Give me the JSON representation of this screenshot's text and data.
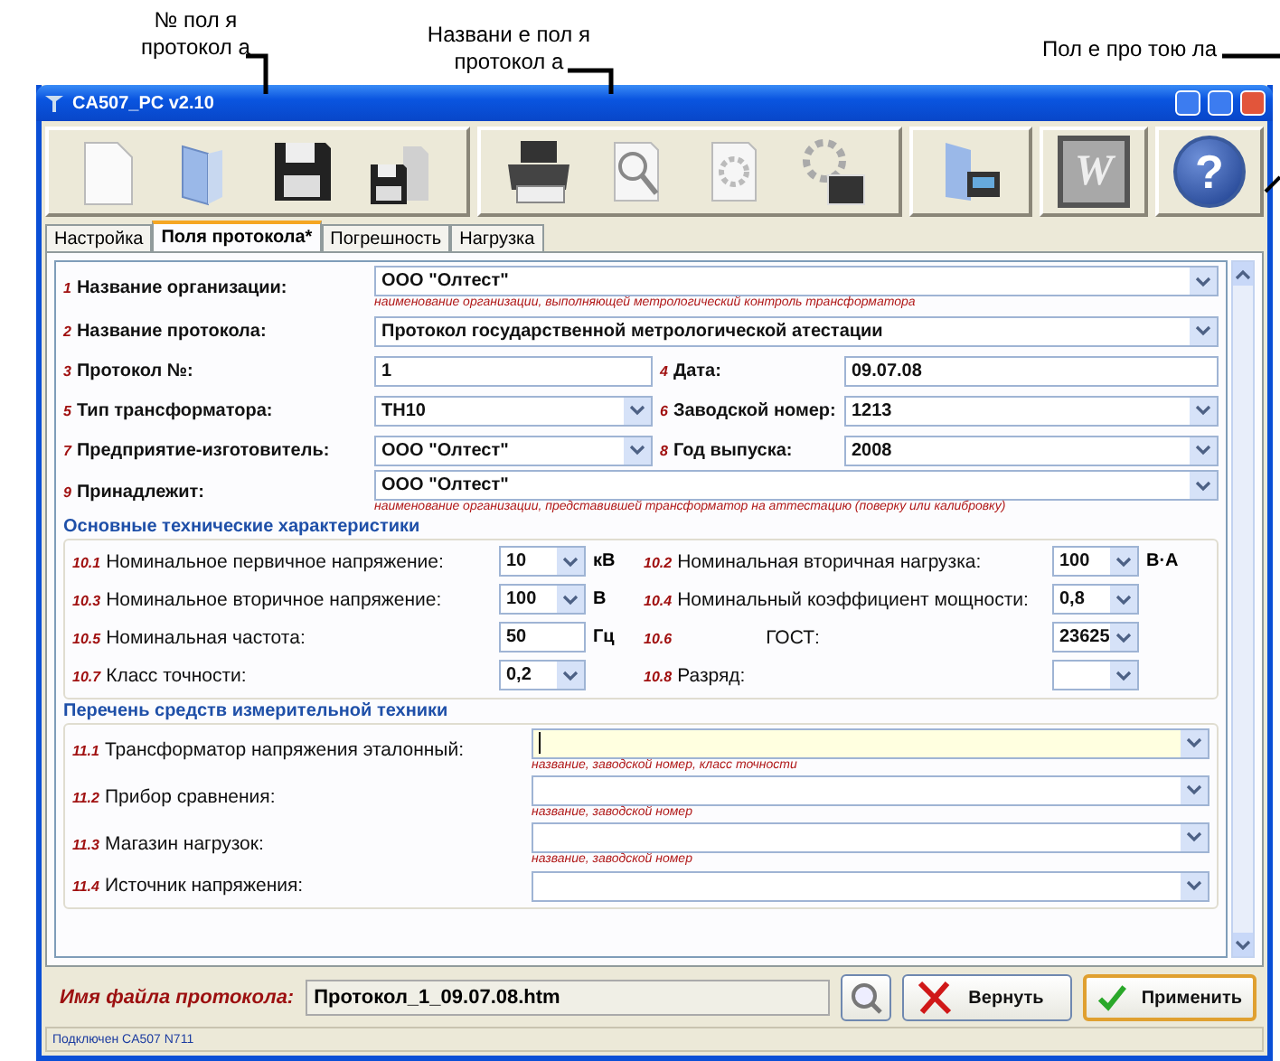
{
  "annotations": [
    {
      "lines": [
        "№ пол я",
        "протокол а"
      ]
    },
    {
      "lines": [
        "Названи е пол я",
        "протокол а"
      ]
    },
    {
      "lines": [
        "Пол е про тою ла"
      ]
    }
  ],
  "window": {
    "title": "CA507_PC v2.10"
  },
  "toolbar": [
    {
      "kind": "group",
      "items": [
        {
          "kind": "new-document"
        },
        {
          "kind": "open-folder"
        },
        {
          "kind": "floppy"
        },
        {
          "kind": "floppy-small"
        }
      ]
    },
    {
      "kind": "group",
      "items": [
        {
          "kind": "printer"
        },
        {
          "kind": "preview"
        },
        {
          "kind": "page-settings"
        },
        {
          "kind": "print-settings"
        }
      ]
    },
    {
      "kind": "group",
      "items": [
        {
          "kind": "folder-device"
        }
      ]
    },
    {
      "kind": "group",
      "items": [
        {
          "kind": "word",
          "label": "W"
        }
      ]
    },
    {
      "kind": "group",
      "items": [
        {
          "kind": "help",
          "label": "?"
        }
      ]
    }
  ],
  "tabs": [
    {
      "label": "Настройка",
      "selected": false
    },
    {
      "label": "Поля протокола*",
      "selected": true
    },
    {
      "label": "Погрешность",
      "selected": false
    },
    {
      "label": "Нагрузка",
      "selected": false
    }
  ],
  "sections": [
    {
      "kind": "fields",
      "rows": [
        {
          "fields": [
            {
              "num": "1",
              "label": "Название организации:",
              "value": "ООО \"Олтест\"",
              "kind": "combo",
              "hint": "наименование организации, выполняющей метрологический контроль трансформатора"
            }
          ]
        },
        {
          "fields": [
            {
              "num": "2",
              "label": "Название протокола:",
              "value": "Протокол государственной метрологической атестации",
              "kind": "combo"
            }
          ]
        },
        {
          "fields": [
            {
              "num": "3",
              "label": "Протокол №:",
              "value": "1",
              "kind": "text"
            },
            {
              "num": "4",
              "label": "Дата:",
              "value": "09.07.08",
              "kind": "text"
            }
          ]
        },
        {
          "fields": [
            {
              "num": "5",
              "label": "Тип трансформатора:",
              "value": "ТН10",
              "kind": "combo"
            },
            {
              "num": "6",
              "label": "Заводской номер:",
              "value": "1213",
              "kind": "combo"
            }
          ]
        },
        {
          "fields": [
            {
              "num": "7",
              "label": "Предприятие-изготовитель:",
              "value": "ООО \"Олтест\"",
              "kind": "combo"
            },
            {
              "num": "8",
              "label": "Год выпуска:",
              "value": "2008",
              "kind": "combo"
            }
          ]
        },
        {
          "fields": [
            {
              "num": "9",
              "label": "Принадлежит:",
              "value": "ООО \"Олтест\"",
              "kind": "combo",
              "hint": "наименование организации, представившей трансформатор на аттестацию (поверку или калибровку)"
            }
          ]
        }
      ]
    },
    {
      "kind": "grid",
      "title": "Основные технические характеристики",
      "rows": [
        {
          "fields": [
            {
              "num": "10.1",
              "label": "Номинальное первичное напряжение:",
              "value": "10",
              "kind": "combo",
              "unit": "кВ"
            },
            {
              "num": "10.2",
              "label": "Номинальная вторичная нагрузка:",
              "value": "100",
              "kind": "combo",
              "unit": "В·А"
            }
          ]
        },
        {
          "fields": [
            {
              "num": "10.3",
              "label": "Номинальное вторичное напряжение:",
              "value": "100",
              "kind": "combo",
              "unit": "В"
            },
            {
              "num": "10.4",
              "label": "Номинальный коэффициент мощности:",
              "value": "0,8",
              "kind": "combo"
            }
          ]
        },
        {
          "fields": [
            {
              "num": "10.5",
              "label": "Номинальная частота:",
              "value": "50",
              "kind": "text",
              "unit": "Гц"
            },
            {
              "num": "10.6",
              "label": "ГОСТ:",
              "value": "23625",
              "kind": "combo",
              "blank": true
            }
          ]
        },
        {
          "fields": [
            {
              "num": "10.7",
              "label": "Класс точности:",
              "value": "0,2",
              "kind": "combo"
            },
            {
              "num": "10.8",
              "label": "Разряд:",
              "kind": "combo"
            }
          ]
        }
      ]
    },
    {
      "kind": "list",
      "title": "Перечень средств измерительной техники",
      "rows": [
        {
          "fields": [
            {
              "num": "11.1",
              "label": "Трансформатор напряжения эталонный:",
              "kind": "combo",
              "focused": true,
              "hint": "название, заводской номер, класс точности"
            }
          ]
        },
        {
          "fields": [
            {
              "num": "11.2",
              "label": "Прибор сравнения:",
              "kind": "combo",
              "focused": false,
              "hint": "название, заводской номер"
            }
          ]
        },
        {
          "fields": [
            {
              "num": "11.3",
              "label": "Магазин нагрузок:",
              "kind": "combo",
              "focused": false,
              "hint": "название, заводской номер"
            }
          ]
        },
        {
          "fields": [
            {
              "num": "11.4",
              "label": "Источник напряжения:",
              "kind": "combo",
              "focused": false
            }
          ]
        }
      ]
    }
  ],
  "footer": {
    "label": "Имя файла протокола:",
    "value": "Протокол_1_09.07.08.htm",
    "buttons": [
      {
        "kind": "browse"
      },
      {
        "kind": "revert",
        "label": "Вернуть",
        "default": false
      },
      {
        "kind": "apply",
        "label": "Применить",
        "default": true
      }
    ]
  },
  "status_bar": "Подключен CA507 N711"
}
